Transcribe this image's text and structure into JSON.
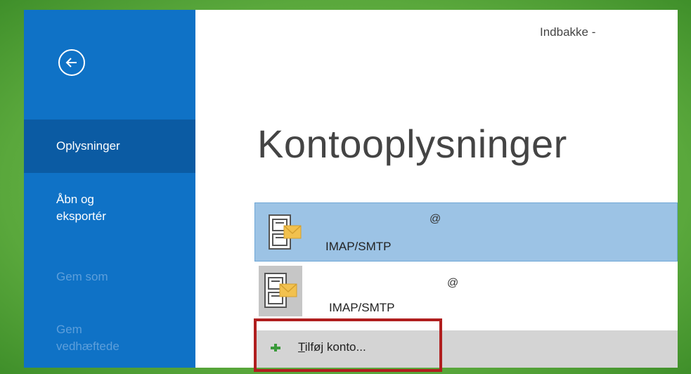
{
  "window": {
    "title": "Indbakke -"
  },
  "sidebar": {
    "back_icon": "back-arrow-icon",
    "items": [
      {
        "label": "Oplysninger",
        "state": "selected"
      },
      {
        "label_line1": "Åbn og",
        "label_line2": "eksportér",
        "state": "normal"
      },
      {
        "label": "Gem som",
        "state": "disabled"
      },
      {
        "label_line1": "Gem",
        "label_line2": "vedhæftede",
        "state": "disabled"
      }
    ]
  },
  "main": {
    "page_title": "Kontooplysninger",
    "accounts": [
      {
        "email": "@",
        "type": "IMAP/SMTP",
        "icon": "email-account-icon",
        "selected": true
      },
      {
        "email": "@",
        "type": "IMAP/SMTP",
        "icon": "email-account-icon",
        "selected": false
      }
    ],
    "add_account": {
      "icon": "plus-icon",
      "accel": "T",
      "label_rest": "ilføj konto..."
    }
  },
  "colors": {
    "sidebar_bg": "#0f72c6",
    "sidebar_selected": "#0b5ba3",
    "account_selected_bg": "#9cc3e5",
    "highlight_border": "#b01e1e",
    "frame_green": "#5aa83c"
  }
}
